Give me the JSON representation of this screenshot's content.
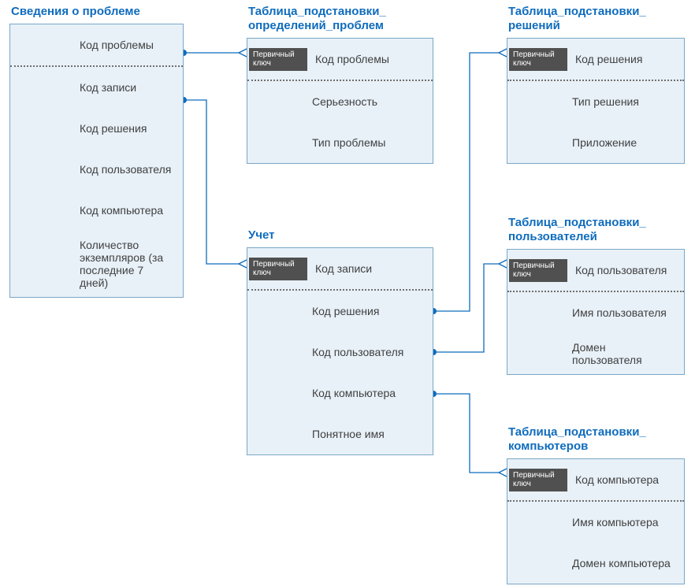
{
  "colors": {
    "accent": "#0f6cbd",
    "panel_bg": "#e8f1f8",
    "panel_border": "#7aa7c7",
    "pk_bg": "#505050"
  },
  "pk_label": "Первичный\nключ",
  "tables": {
    "issue_details": {
      "title": "Сведения о проблеме",
      "rows": [
        {
          "label": "Код проблемы"
        },
        {
          "label": "Код записи"
        },
        {
          "label": "Код решения"
        },
        {
          "label": "Код пользователя"
        },
        {
          "label": "Код компьютера"
        },
        {
          "label": "Количество экземпляров (за последние 7 дней)"
        }
      ]
    },
    "problem_lookup": {
      "title": "Таблица_подстановки_\nопределений_проблем",
      "rows": [
        {
          "label": "Код проблемы",
          "pk": true
        },
        {
          "label": "Серьезность"
        },
        {
          "label": "Тип проблемы"
        }
      ]
    },
    "solution_lookup": {
      "title": "Таблица_подстановки_\nрешений",
      "rows": [
        {
          "label": "Код решения",
          "pk": true
        },
        {
          "label": "Тип решения"
        },
        {
          "label": "Приложение"
        }
      ]
    },
    "accounting": {
      "title": "Учет",
      "rows": [
        {
          "label": "Код записи",
          "pk": true
        },
        {
          "label": "Код решения"
        },
        {
          "label": "Код пользователя"
        },
        {
          "label": "Код компьютера"
        },
        {
          "label": "Понятное имя"
        }
      ]
    },
    "user_lookup": {
      "title": "Таблица_подстановки_\nпользователей",
      "rows": [
        {
          "label": "Код пользователя",
          "pk": true
        },
        {
          "label": "Имя пользователя"
        },
        {
          "label": "Домен пользователя"
        }
      ]
    },
    "computer_lookup": {
      "title": "Таблица_подстановки_\nкомпьютеров",
      "rows": [
        {
          "label": "Код компьютера",
          "pk": true
        },
        {
          "label": "Имя компьютера"
        },
        {
          "label": "Домен компьютера"
        }
      ]
    }
  }
}
